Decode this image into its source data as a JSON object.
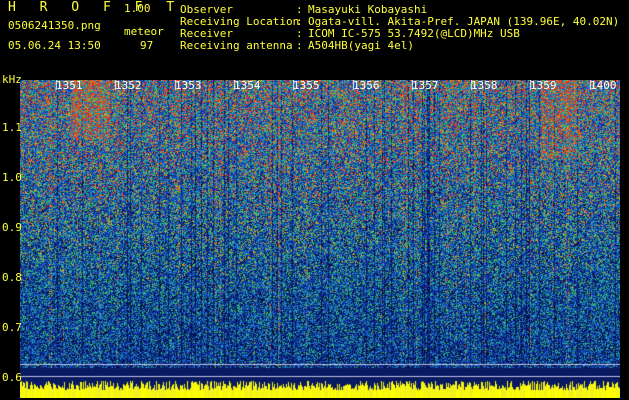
{
  "header": {
    "app_title": "H R O F F T",
    "version": "1.00",
    "filename": "0506241350.png",
    "datetime": "05.06.24 13:50",
    "meteor_label": "meteor",
    "meteor_count": "97"
  },
  "info": [
    {
      "key": "Observer",
      "value": "Masayuki Kobayashi"
    },
    {
      "key": "Receiving Location",
      "value": "Ogata-vill. Akita-Pref. JAPAN (139.96E, 40.02N)"
    },
    {
      "key": "Receiver",
      "value": "ICOM IC-575 53.7492(@LCD)MHz USB"
    },
    {
      "key": "Receiving antenna",
      "value": "A504HB(yagi 4el)"
    }
  ],
  "separator": ":",
  "chart_data": {
    "type": "heatmap",
    "ylabel": "kHz",
    "y_ticks": [
      "1.1",
      "1.0",
      "0.9",
      "0.8",
      "0.7",
      "0.6"
    ],
    "y_tick_values": [
      1.1,
      1.0,
      0.9,
      0.8,
      0.7,
      0.6
    ],
    "x_ticks": [
      "1351",
      "1352",
      "1353",
      "1354",
      "1355",
      "1356",
      "1357",
      "1358",
      "1359",
      "1400"
    ],
    "colors": {
      "text": "#ffff3a",
      "high": "#ff3000",
      "mid": "#20c060",
      "low": "#1030a0",
      "base": "#ffff00"
    }
  }
}
